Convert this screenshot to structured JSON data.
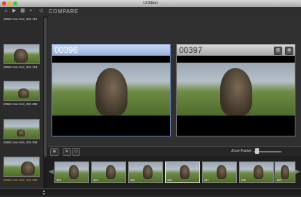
{
  "window": {
    "title": "Untitled"
  },
  "toolbar": {
    "icons": [
      "home-icon",
      "play-icon",
      "grid-icon",
      "search-icon",
      "back-icon"
    ],
    "compare_label": "COMPARE"
  },
  "sidebar": {
    "clips": [
      {
        "label": "00061.mov Keri_001-110"
      },
      {
        "label": "00061.mov Keri_001-154"
      },
      {
        "label": "00061.mov Keri_001-388"
      },
      {
        "label": "00061.mov Keri_001-308"
      },
      {
        "label": "00061.mov Keri_001-396"
      }
    ]
  },
  "compare": {
    "left": {
      "frame": "00396"
    },
    "right": {
      "frame": "00397"
    }
  },
  "controls": {
    "zoom_label": "Zoom Factor:"
  },
  "filmstrip": {
    "frames": [
      {
        "label": "393"
      },
      {
        "label": "394"
      },
      {
        "label": "395"
      },
      {
        "label": "396"
      },
      {
        "label": "397"
      },
      {
        "label": "398"
      },
      {
        "label": "400"
      }
    ]
  }
}
